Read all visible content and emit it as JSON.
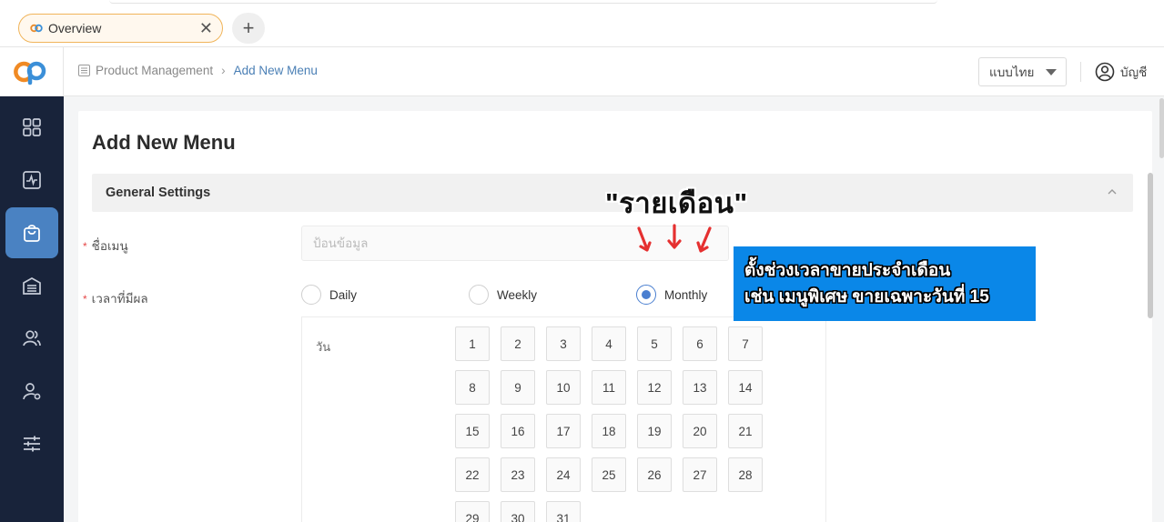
{
  "tabs": [
    {
      "label": "Overview"
    }
  ],
  "header": {
    "breadcrumb": [
      "Product Management",
      "Add New Menu"
    ],
    "language_select": "แบบไทย",
    "account_label": "บัญชี"
  },
  "sidebar": {
    "items": [
      {
        "icon": "dashboard-grid-icon"
      },
      {
        "icon": "activity-chart-icon"
      },
      {
        "icon": "shopping-bag-icon",
        "active": true
      },
      {
        "icon": "inventory-icon"
      },
      {
        "icon": "users-group-icon"
      },
      {
        "icon": "user-settings-icon"
      },
      {
        "icon": "sliders-icon"
      }
    ]
  },
  "main": {
    "title": "Add New Menu",
    "section_title": "General Settings",
    "menu_name_label": "ชื่อเมนู",
    "menu_name_placeholder": "ป้อนข้อมูล",
    "period_label": "เวลาที่มีผล",
    "period_options": [
      "Daily",
      "Weekly",
      "Monthly"
    ],
    "period_selected": "Monthly",
    "day_label": "วัน",
    "days": [
      "1",
      "2",
      "3",
      "4",
      "5",
      "6",
      "7",
      "8",
      "9",
      "10",
      "11",
      "12",
      "13",
      "14",
      "15",
      "16",
      "17",
      "18",
      "19",
      "20",
      "21",
      "22",
      "23",
      "24",
      "25",
      "26",
      "27",
      "28",
      "29",
      "30",
      "31"
    ]
  },
  "annotation": {
    "title": "\"รายเดือน\"",
    "box_line1": "ตั้งช่วงเวลาขายประจำเดือน",
    "box_line2": "เช่น เมนูพิเศษ ขายเฉพาะวันที่ 15",
    "arrow_color": "#e53030",
    "box_color": "#0a87e8"
  },
  "colors": {
    "accent": "#4a82c2",
    "tab_border": "#f0b45a",
    "sidebar_bg": "#18233a",
    "required": "#e54848"
  }
}
